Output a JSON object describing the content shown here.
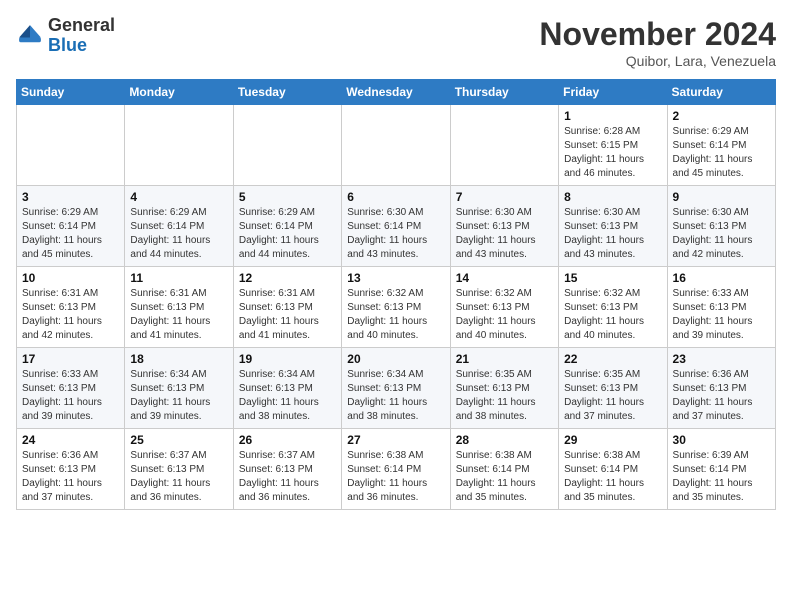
{
  "header": {
    "logo_line1": "General",
    "logo_line2": "Blue",
    "month_title": "November 2024",
    "location": "Quibor, Lara, Venezuela"
  },
  "weekdays": [
    "Sunday",
    "Monday",
    "Tuesday",
    "Wednesday",
    "Thursday",
    "Friday",
    "Saturday"
  ],
  "weeks": [
    [
      {
        "day": "",
        "info": ""
      },
      {
        "day": "",
        "info": ""
      },
      {
        "day": "",
        "info": ""
      },
      {
        "day": "",
        "info": ""
      },
      {
        "day": "",
        "info": ""
      },
      {
        "day": "1",
        "info": "Sunrise: 6:28 AM\nSunset: 6:15 PM\nDaylight: 11 hours\nand 46 minutes."
      },
      {
        "day": "2",
        "info": "Sunrise: 6:29 AM\nSunset: 6:14 PM\nDaylight: 11 hours\nand 45 minutes."
      }
    ],
    [
      {
        "day": "3",
        "info": "Sunrise: 6:29 AM\nSunset: 6:14 PM\nDaylight: 11 hours\nand 45 minutes."
      },
      {
        "day": "4",
        "info": "Sunrise: 6:29 AM\nSunset: 6:14 PM\nDaylight: 11 hours\nand 44 minutes."
      },
      {
        "day": "5",
        "info": "Sunrise: 6:29 AM\nSunset: 6:14 PM\nDaylight: 11 hours\nand 44 minutes."
      },
      {
        "day": "6",
        "info": "Sunrise: 6:30 AM\nSunset: 6:14 PM\nDaylight: 11 hours\nand 43 minutes."
      },
      {
        "day": "7",
        "info": "Sunrise: 6:30 AM\nSunset: 6:13 PM\nDaylight: 11 hours\nand 43 minutes."
      },
      {
        "day": "8",
        "info": "Sunrise: 6:30 AM\nSunset: 6:13 PM\nDaylight: 11 hours\nand 43 minutes."
      },
      {
        "day": "9",
        "info": "Sunrise: 6:30 AM\nSunset: 6:13 PM\nDaylight: 11 hours\nand 42 minutes."
      }
    ],
    [
      {
        "day": "10",
        "info": "Sunrise: 6:31 AM\nSunset: 6:13 PM\nDaylight: 11 hours\nand 42 minutes."
      },
      {
        "day": "11",
        "info": "Sunrise: 6:31 AM\nSunset: 6:13 PM\nDaylight: 11 hours\nand 41 minutes."
      },
      {
        "day": "12",
        "info": "Sunrise: 6:31 AM\nSunset: 6:13 PM\nDaylight: 11 hours\nand 41 minutes."
      },
      {
        "day": "13",
        "info": "Sunrise: 6:32 AM\nSunset: 6:13 PM\nDaylight: 11 hours\nand 40 minutes."
      },
      {
        "day": "14",
        "info": "Sunrise: 6:32 AM\nSunset: 6:13 PM\nDaylight: 11 hours\nand 40 minutes."
      },
      {
        "day": "15",
        "info": "Sunrise: 6:32 AM\nSunset: 6:13 PM\nDaylight: 11 hours\nand 40 minutes."
      },
      {
        "day": "16",
        "info": "Sunrise: 6:33 AM\nSunset: 6:13 PM\nDaylight: 11 hours\nand 39 minutes."
      }
    ],
    [
      {
        "day": "17",
        "info": "Sunrise: 6:33 AM\nSunset: 6:13 PM\nDaylight: 11 hours\nand 39 minutes."
      },
      {
        "day": "18",
        "info": "Sunrise: 6:34 AM\nSunset: 6:13 PM\nDaylight: 11 hours\nand 39 minutes."
      },
      {
        "day": "19",
        "info": "Sunrise: 6:34 AM\nSunset: 6:13 PM\nDaylight: 11 hours\nand 38 minutes."
      },
      {
        "day": "20",
        "info": "Sunrise: 6:34 AM\nSunset: 6:13 PM\nDaylight: 11 hours\nand 38 minutes."
      },
      {
        "day": "21",
        "info": "Sunrise: 6:35 AM\nSunset: 6:13 PM\nDaylight: 11 hours\nand 38 minutes."
      },
      {
        "day": "22",
        "info": "Sunrise: 6:35 AM\nSunset: 6:13 PM\nDaylight: 11 hours\nand 37 minutes."
      },
      {
        "day": "23",
        "info": "Sunrise: 6:36 AM\nSunset: 6:13 PM\nDaylight: 11 hours\nand 37 minutes."
      }
    ],
    [
      {
        "day": "24",
        "info": "Sunrise: 6:36 AM\nSunset: 6:13 PM\nDaylight: 11 hours\nand 37 minutes."
      },
      {
        "day": "25",
        "info": "Sunrise: 6:37 AM\nSunset: 6:13 PM\nDaylight: 11 hours\nand 36 minutes."
      },
      {
        "day": "26",
        "info": "Sunrise: 6:37 AM\nSunset: 6:13 PM\nDaylight: 11 hours\nand 36 minutes."
      },
      {
        "day": "27",
        "info": "Sunrise: 6:38 AM\nSunset: 6:14 PM\nDaylight: 11 hours\nand 36 minutes."
      },
      {
        "day": "28",
        "info": "Sunrise: 6:38 AM\nSunset: 6:14 PM\nDaylight: 11 hours\nand 35 minutes."
      },
      {
        "day": "29",
        "info": "Sunrise: 6:38 AM\nSunset: 6:14 PM\nDaylight: 11 hours\nand 35 minutes."
      },
      {
        "day": "30",
        "info": "Sunrise: 6:39 AM\nSunset: 6:14 PM\nDaylight: 11 hours\nand 35 minutes."
      }
    ]
  ]
}
